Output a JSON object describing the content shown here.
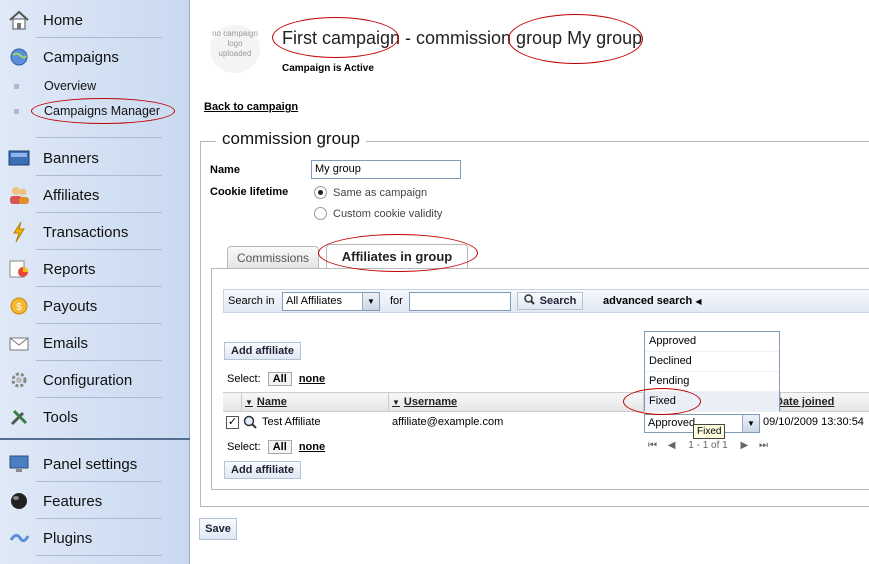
{
  "sidebar": {
    "items": [
      {
        "label": "Home",
        "icon": "home-icon"
      },
      {
        "label": "Campaigns",
        "icon": "globe-icon"
      },
      {
        "label": "Banners",
        "icon": "banner-icon"
      },
      {
        "label": "Affiliates",
        "icon": "users-icon"
      },
      {
        "label": "Transactions",
        "icon": "lightning-icon"
      },
      {
        "label": "Reports",
        "icon": "reports-icon"
      },
      {
        "label": "Payouts",
        "icon": "coin-icon"
      },
      {
        "label": "Emails",
        "icon": "envelope-icon"
      },
      {
        "label": "Configuration",
        "icon": "gear-icon"
      },
      {
        "label": "Tools",
        "icon": "tools-icon"
      },
      {
        "label": "Panel settings",
        "icon": "monitor-icon"
      },
      {
        "label": "Features",
        "icon": "ball-icon"
      },
      {
        "label": "Plugins",
        "icon": "plug-icon"
      }
    ],
    "campaign_sub": [
      {
        "label": "Overview"
      },
      {
        "label": "Campaigns Manager"
      }
    ]
  },
  "header": {
    "logo_text": "no campaign logo uploaded",
    "title": "First campaign - commission group My group",
    "status": "Campaign is Active",
    "back_link": "Back to campaign"
  },
  "form": {
    "legend": "commission group",
    "name_label": "Name",
    "name_value": "My group",
    "cookie_label": "Cookie lifetime",
    "radio_same": "Same as campaign",
    "radio_custom": "Custom cookie validity"
  },
  "tabs": [
    {
      "label": "Commissions"
    },
    {
      "label": "Affiliates in group"
    }
  ],
  "search": {
    "search_in_label": "Search in",
    "scope_value": "All Affiliates",
    "for_label": "for",
    "query": "",
    "button": "Search",
    "advanced": "advanced search"
  },
  "grid": {
    "add_button": "Add affiliate",
    "select_label": "Select:",
    "all_button": "All",
    "none_link": "none",
    "columns": [
      "Name",
      "Username",
      "Date joined"
    ],
    "rows": [
      {
        "name": "Test Affiliate",
        "username": "affiliate@example.com",
        "status": "Approved",
        "date": "09/10/2009 13:30:54"
      }
    ],
    "pager": "1 - 1 of 1"
  },
  "status_dropdown": {
    "options": [
      "Approved",
      "Declined",
      "Pending",
      "Fixed"
    ],
    "highlighted": "Fixed",
    "tooltip": "Fixed"
  },
  "save_button": "Save"
}
